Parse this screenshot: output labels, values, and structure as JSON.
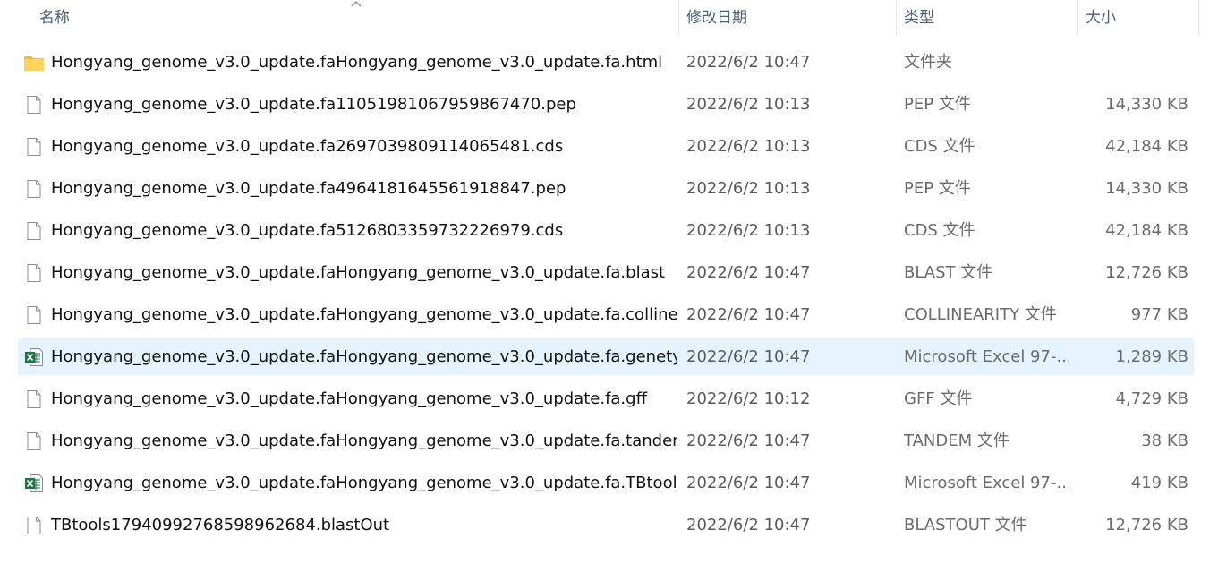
{
  "columns": {
    "name": "名称",
    "date": "修改日期",
    "type": "类型",
    "size": "大小"
  },
  "sort": {
    "column": "name",
    "direction": "ascending",
    "icon": "chevron-up-icon"
  },
  "files": [
    {
      "name": "Hongyang_genome_v3.0_update.faHongyang_genome_v3.0_update.fa.html",
      "date": "2022/6/2 10:47",
      "type": "文件夹",
      "size": "",
      "icon": "folder-icon",
      "selected": false
    },
    {
      "name": "Hongyang_genome_v3.0_update.fa1105198106795986747​0.pep",
      "date": "2022/6/2 10:13",
      "type": "PEP 文件",
      "size": "14,330 KB",
      "icon": "file-icon",
      "selected": false
    },
    {
      "name": "Hongyang_genome_v3.0_update.fa2697039809114065481.cds",
      "date": "2022/6/2 10:13",
      "type": "CDS 文件",
      "size": "42,184 KB",
      "icon": "file-icon",
      "selected": false
    },
    {
      "name": "Hongyang_genome_v3.0_update.fa4964181645561918847.pep",
      "date": "2022/6/2 10:13",
      "type": "PEP 文件",
      "size": "14,330 KB",
      "icon": "file-icon",
      "selected": false
    },
    {
      "name": "Hongyang_genome_v3.0_update.fa5126803359732226979.cds",
      "date": "2022/6/2 10:13",
      "type": "CDS 文件",
      "size": "42,184 KB",
      "icon": "file-icon",
      "selected": false
    },
    {
      "name": "Hongyang_genome_v3.0_update.faHongyang_genome_v3.0_update.fa.blast",
      "date": "2022/6/2 10:47",
      "type": "BLAST 文件",
      "size": "12,726 KB",
      "icon": "file-icon",
      "selected": false
    },
    {
      "name": "Hongyang_genome_v3.0_update.faHongyang_genome_v3.0_update.fa.collinea...",
      "date": "2022/6/2 10:47",
      "type": "COLLINEARITY 文件",
      "size": "977 KB",
      "icon": "file-icon",
      "selected": false
    },
    {
      "name": "Hongyang_genome_v3.0_update.faHongyang_genome_v3.0_update.fa.genety...",
      "date": "2022/6/2 10:47",
      "type": "Microsoft Excel 97-...",
      "size": "1,289 KB",
      "icon": "excel-icon",
      "selected": true
    },
    {
      "name": "Hongyang_genome_v3.0_update.faHongyang_genome_v3.0_update.fa.gff",
      "date": "2022/6/2 10:12",
      "type": "GFF 文件",
      "size": "4,729 KB",
      "icon": "file-icon",
      "selected": false
    },
    {
      "name": "Hongyang_genome_v3.0_update.faHongyang_genome_v3.0_update.fa.tandem",
      "date": "2022/6/2 10:47",
      "type": "TANDEM 文件",
      "size": "38 KB",
      "icon": "file-icon",
      "selected": false
    },
    {
      "name": "Hongyang_genome_v3.0_update.faHongyang_genome_v3.0_update.fa.TBtools....",
      "date": "2022/6/2 10:47",
      "type": "Microsoft Excel 97-...",
      "size": "419 KB",
      "icon": "excel-icon",
      "selected": false
    },
    {
      "name": "TBtools17940992768598962684.blastOut",
      "date": "2022/6/2 10:47",
      "type": "BLASTOUT 文件",
      "size": "12,726 KB",
      "icon": "file-icon",
      "selected": false
    }
  ],
  "colors": {
    "selected_row": "#e5f3ff",
    "header_text": "#4c607a",
    "folder": "#f8c94a",
    "excel": "#1d7344"
  }
}
